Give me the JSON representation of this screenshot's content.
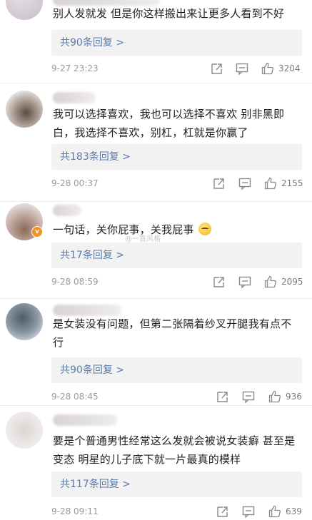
{
  "comments": [
    {
      "text": "别人发就发 但是你这样搬出来让更多人看到不好",
      "replies_label": "共90条回复 >",
      "time": "9-27 23:23",
      "likes": "3204"
    },
    {
      "text": "我可以选择喜欢，我也可以选择不喜欢 别非黑即白，我选择不喜欢，别杠，杠就是你赢了",
      "replies_label": "共183条回复 >",
      "time": "9-28 00:37",
      "likes": "2155"
    },
    {
      "text": "一句话，关你屁事，关我屁事",
      "replies_label": "共17条回复 >",
      "time": "9-28 08:59",
      "likes": "2095"
    },
    {
      "text": "是女装没有问题，但第二张隔着纱叉开腿我有点不行",
      "replies_label": "共90条回复 >",
      "time": "9-28 08:45",
      "likes": "936"
    },
    {
      "text": "要是个普通男性经常这么发就会被说女装癖 甚至是变态  明星的儿子底下就一片最真的模样",
      "replies_label": "共117条回复 >",
      "time": "9-28 09:11",
      "likes": "639"
    }
  ],
  "watermark": "@一直风格",
  "badge_letter": "v",
  "icons": {
    "share": "share-icon",
    "comment": "comment-icon",
    "like": "like-icon",
    "emoji": "smirk-emoji-icon"
  }
}
